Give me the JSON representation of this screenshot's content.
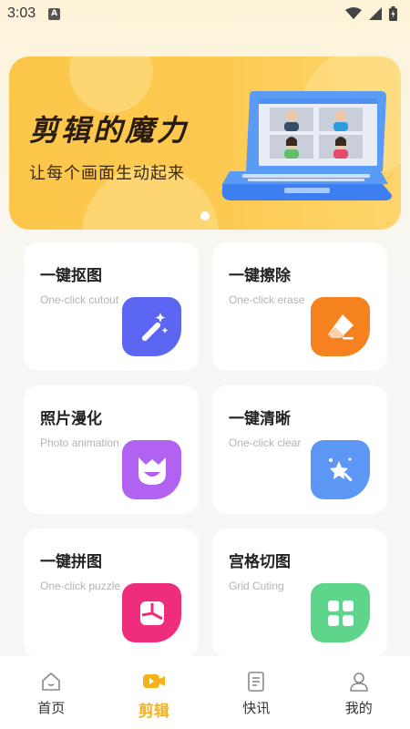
{
  "status_bar": {
    "time": "3:03",
    "indicator": "A"
  },
  "banner": {
    "title": "剪辑的魔力",
    "subtitle": "让每个画面生动起来"
  },
  "features": [
    {
      "title": "一键抠图",
      "subtitle": "One-click cutout",
      "icon": "magic-wand-icon",
      "color": "#5b67f2"
    },
    {
      "title": "一键擦除",
      "subtitle": "One-click erase",
      "icon": "eraser-icon",
      "color": "#f5821f"
    },
    {
      "title": "照片漫化",
      "subtitle": "Photo animation",
      "icon": "cartoon-face-icon",
      "color": "#b162f0"
    },
    {
      "title": "一键清晰",
      "subtitle": "One-click clear",
      "icon": "sparkle-wand-icon",
      "color": "#5d97f6"
    },
    {
      "title": "一键拼图",
      "subtitle": "One-click puzzle",
      "icon": "puzzle-collage-icon",
      "color": "#ee2d7c"
    },
    {
      "title": "宫格切图",
      "subtitle": "Grid Cuting",
      "icon": "grid-icon",
      "color": "#5fd48b"
    }
  ],
  "nav": {
    "items": [
      {
        "label": "首页",
        "icon": "home-icon"
      },
      {
        "label": "剪辑",
        "icon": "video-edit-icon",
        "active": true
      },
      {
        "label": "快讯",
        "icon": "news-icon"
      },
      {
        "label": "我的",
        "icon": "profile-icon"
      }
    ]
  },
  "colors": {
    "accent": "#f6b21a",
    "banner": "#fcc64a"
  }
}
